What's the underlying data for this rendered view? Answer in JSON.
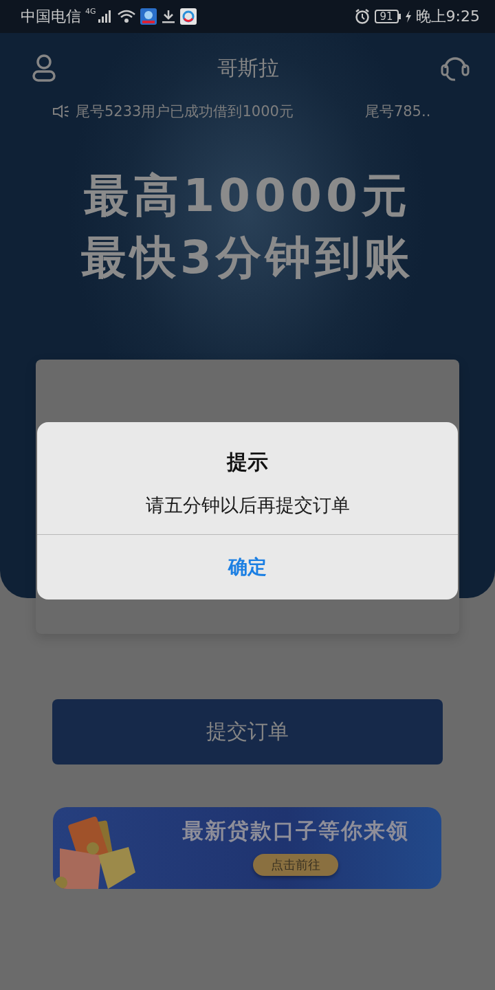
{
  "status_bar": {
    "carrier": "中国电信",
    "network": "4G",
    "battery": "91",
    "time": "晚上9:25"
  },
  "header": {
    "title": "哥斯拉"
  },
  "notices": [
    "尾号5233用户已成功借到1000元",
    "尾号785.."
  ],
  "headline": [
    "最高10000元",
    "最快3分钟到账"
  ],
  "submit_button": "提交订单",
  "banner": {
    "title": "最新贷款口子等你来领",
    "button": "点击前往"
  },
  "dialog": {
    "title": "提示",
    "message": "请五分钟以后再提交订单",
    "button": "确定"
  }
}
